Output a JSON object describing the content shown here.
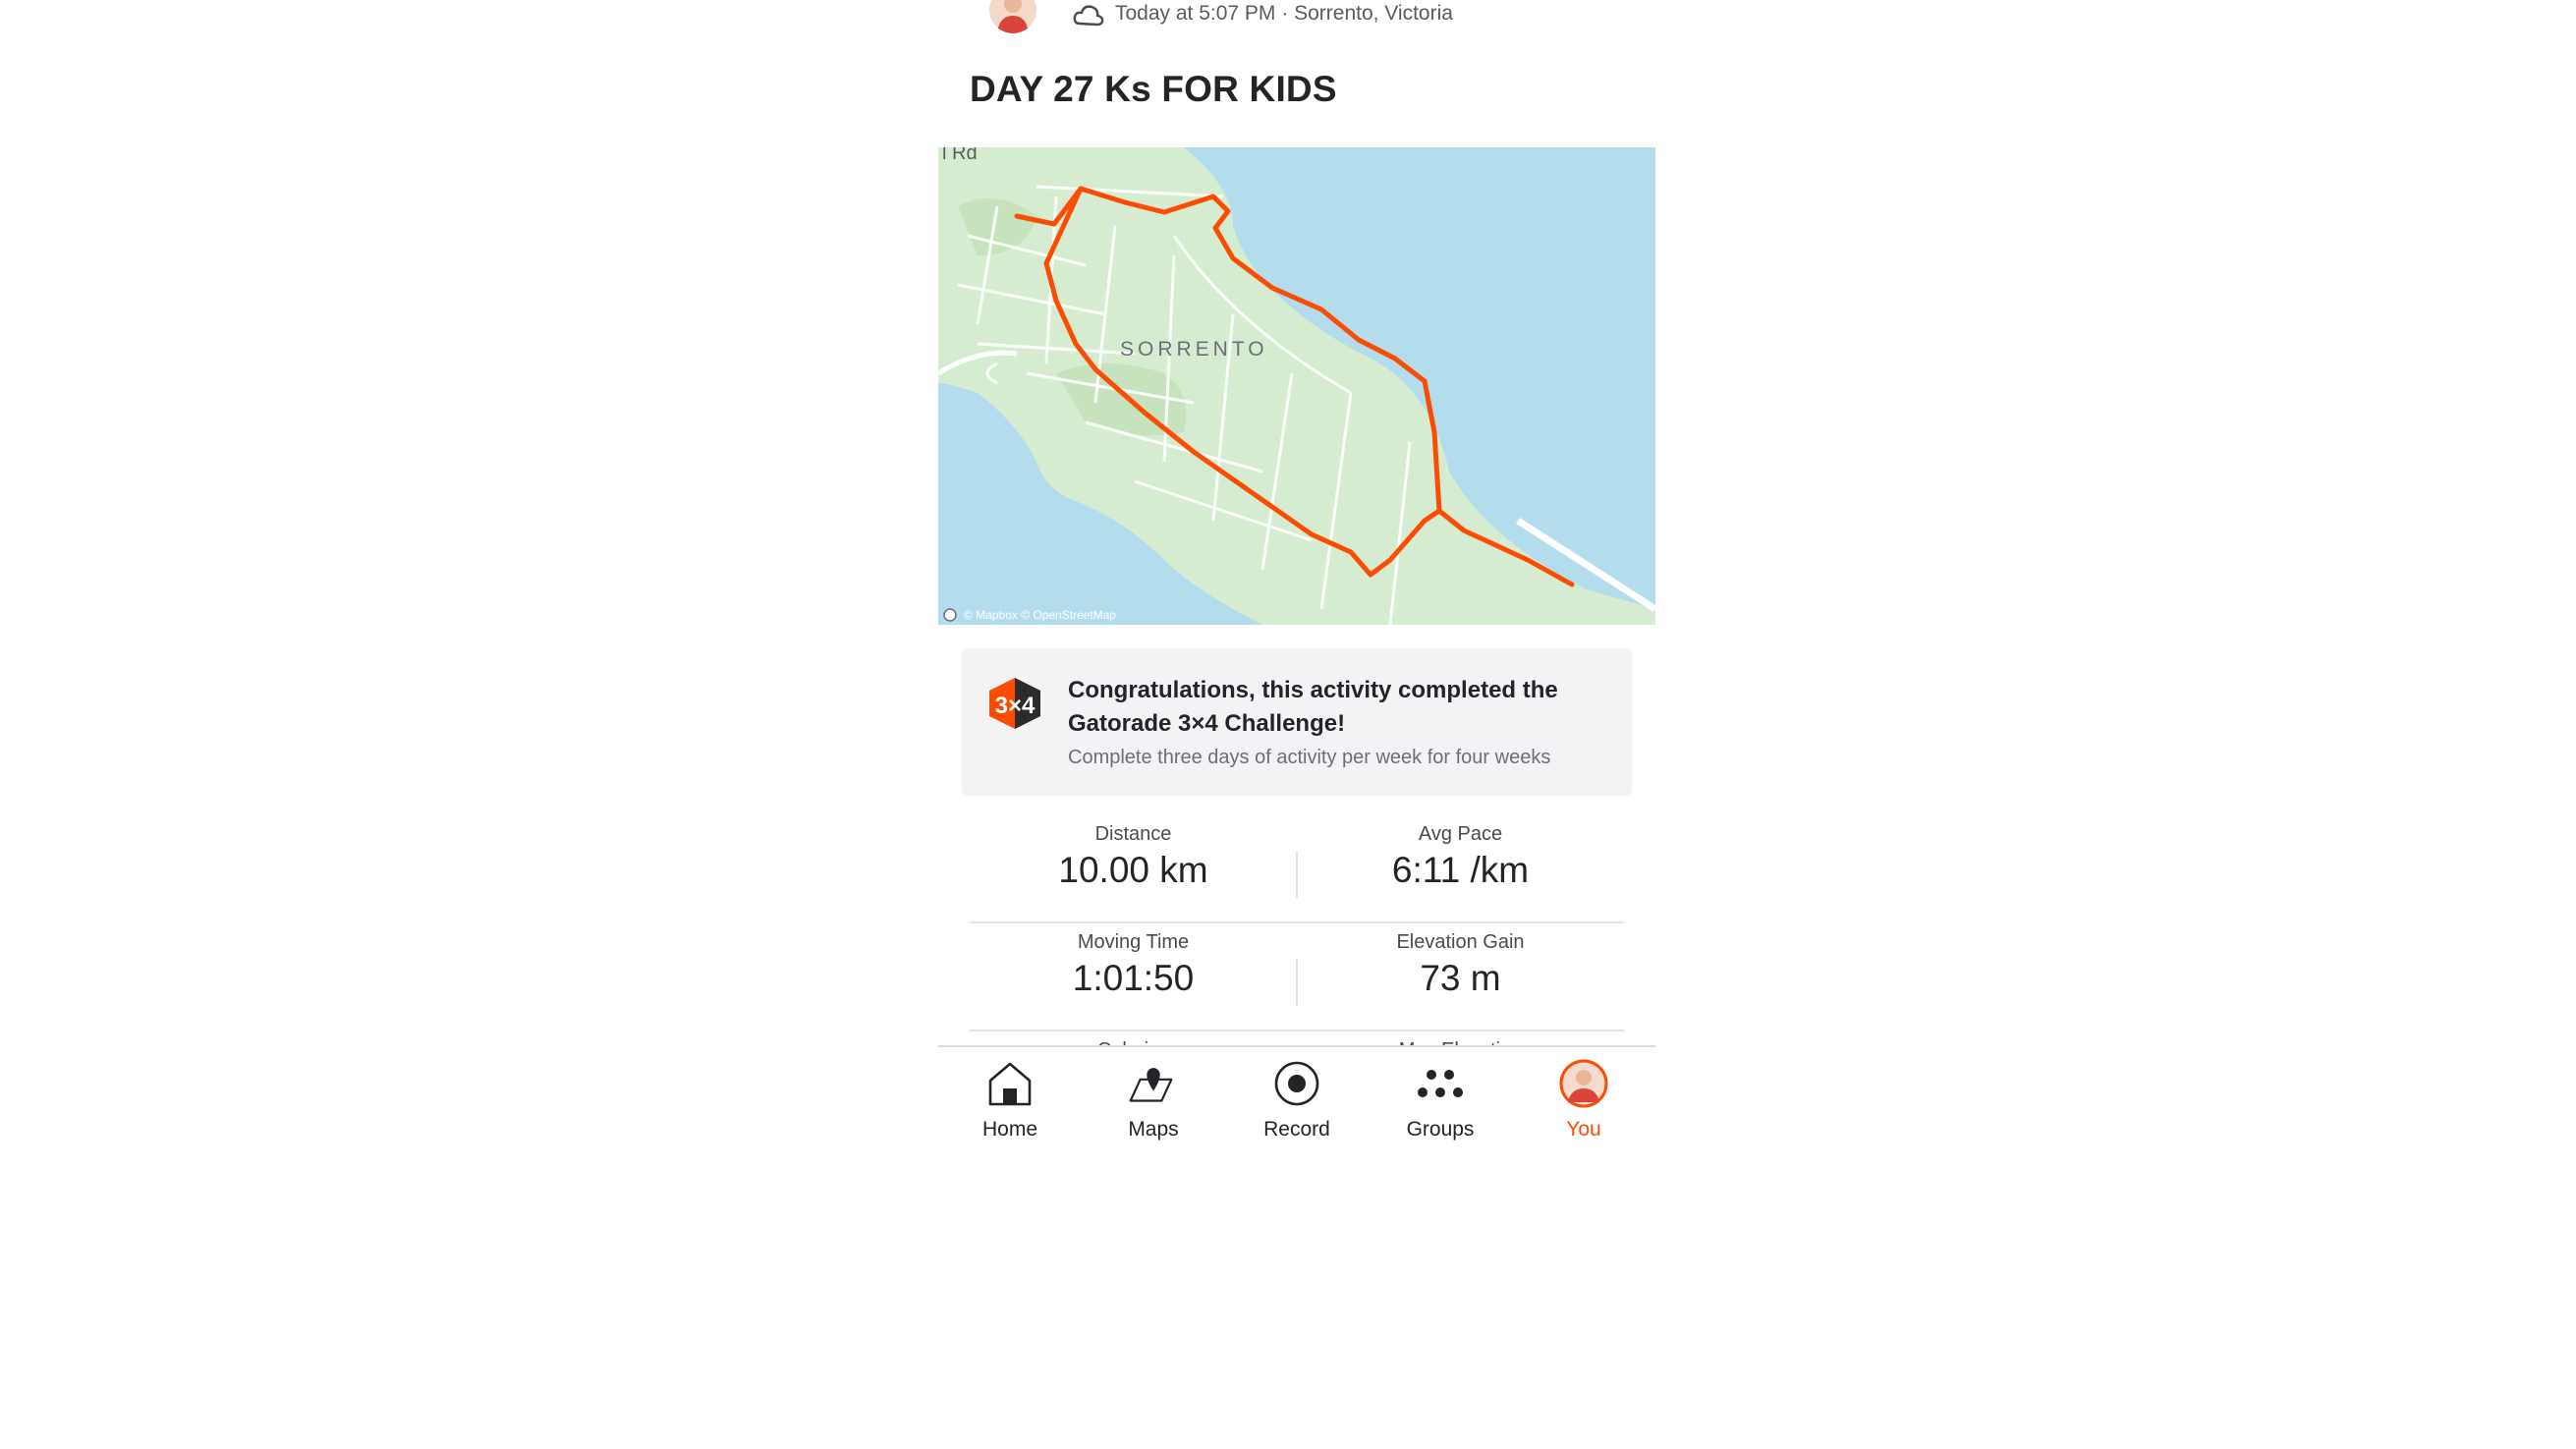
{
  "header": {
    "meta": "Today at 5:07 PM · Sorrento, Victoria",
    "weather_icon": "cloud-icon"
  },
  "activity": {
    "title": "DAY 27 Ks FOR KIDS"
  },
  "map": {
    "road_label": "l Rd",
    "town_label": "SORRENTO",
    "attribution": "© Mapbox © OpenStreetMap",
    "route_color": "#fc4c02",
    "water_color": "#b3dcec",
    "land_color": "#d6ecd0"
  },
  "challenge": {
    "badge_text": "3×4",
    "title": "Congratulations, this activity completed the Gatorade 3×4 Challenge!",
    "subtitle": "Complete three days of activity per week for four weeks"
  },
  "stats": [
    {
      "label": "Distance",
      "value": "10.00 km"
    },
    {
      "label": "Avg Pace",
      "value": "6:11 /km"
    },
    {
      "label": "Moving Time",
      "value": "1:01:50"
    },
    {
      "label": "Elevation Gain",
      "value": "73 m"
    },
    {
      "label": "Calories",
      "value": ""
    },
    {
      "label": "Max Elevation",
      "value": ""
    }
  ],
  "tabbar": {
    "active_color": "#fc4c02",
    "tabs": [
      {
        "label": "Home",
        "icon": "home-icon"
      },
      {
        "label": "Maps",
        "icon": "map-pin-icon"
      },
      {
        "label": "Record",
        "icon": "record-icon"
      },
      {
        "label": "Groups",
        "icon": "groups-icon"
      },
      {
        "label": "You",
        "icon": "avatar-icon"
      }
    ]
  }
}
